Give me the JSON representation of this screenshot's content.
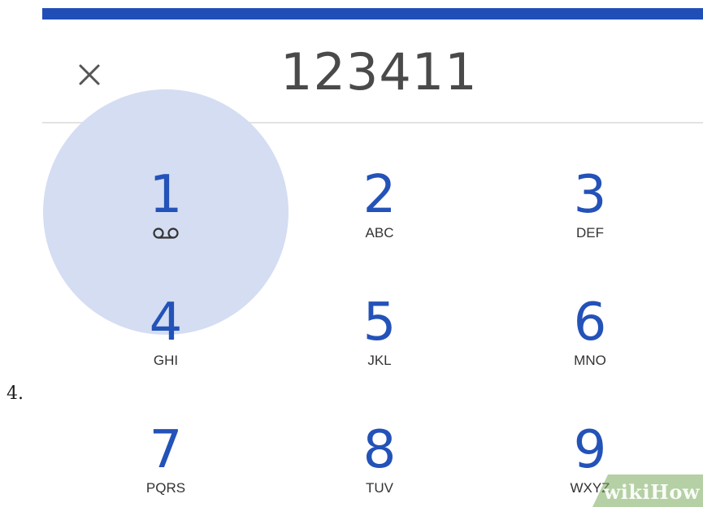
{
  "step_number": "4.",
  "dialer": {
    "dialed_number": "123411",
    "clear_icon": "close-icon",
    "keys": [
      {
        "digit": "1",
        "letters": "",
        "icon": "voicemail-icon"
      },
      {
        "digit": "2",
        "letters": "ABC"
      },
      {
        "digit": "3",
        "letters": "DEF"
      },
      {
        "digit": "4",
        "letters": "GHI"
      },
      {
        "digit": "5",
        "letters": "JKL"
      },
      {
        "digit": "6",
        "letters": "MNO"
      },
      {
        "digit": "7",
        "letters": "PQRS"
      },
      {
        "digit": "8",
        "letters": "TUV"
      },
      {
        "digit": "9",
        "letters": "WXYZ"
      }
    ]
  },
  "watermark": "wikiHow",
  "colors": {
    "accent_bar": "#1f4fb6",
    "digit": "#2352b8",
    "ripple": "#d4ddf2",
    "number_text": "#4a4a4a"
  }
}
